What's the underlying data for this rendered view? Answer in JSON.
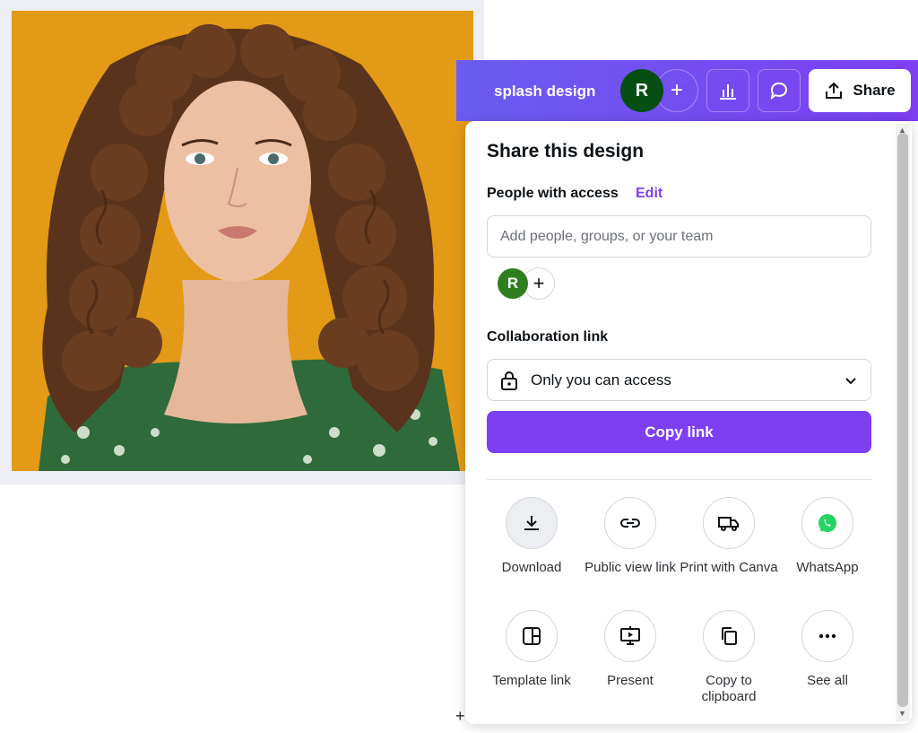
{
  "design_title": "splash design",
  "topbar": {
    "avatar_initial": "R",
    "share_label": "Share"
  },
  "panel": {
    "title": "Share this design",
    "people_access_label": "People with access",
    "edit_label": "Edit",
    "add_people_placeholder": "Add people, groups, or your team",
    "member_initial": "R",
    "collaboration_label": "Collaboration link",
    "access_selected": "Only you can access",
    "copy_link_label": "Copy link",
    "options": [
      {
        "label": "Download",
        "icon": "download-icon"
      },
      {
        "label": "Public view link",
        "icon": "link-icon"
      },
      {
        "label": "Print with Canva",
        "icon": "truck-icon"
      },
      {
        "label": "WhatsApp",
        "icon": "whatsapp-icon"
      },
      {
        "label": "Template link",
        "icon": "template-icon"
      },
      {
        "label": "Present",
        "icon": "present-icon"
      },
      {
        "label": "Copy to clipboard",
        "icon": "copy-icon"
      },
      {
        "label": "See all",
        "icon": "more-icon"
      }
    ]
  },
  "colors": {
    "accent": "#7d3ff2",
    "topbar_start": "#6a5cf0",
    "photo_background": "#e59a16",
    "whatsapp": "#25d366"
  }
}
